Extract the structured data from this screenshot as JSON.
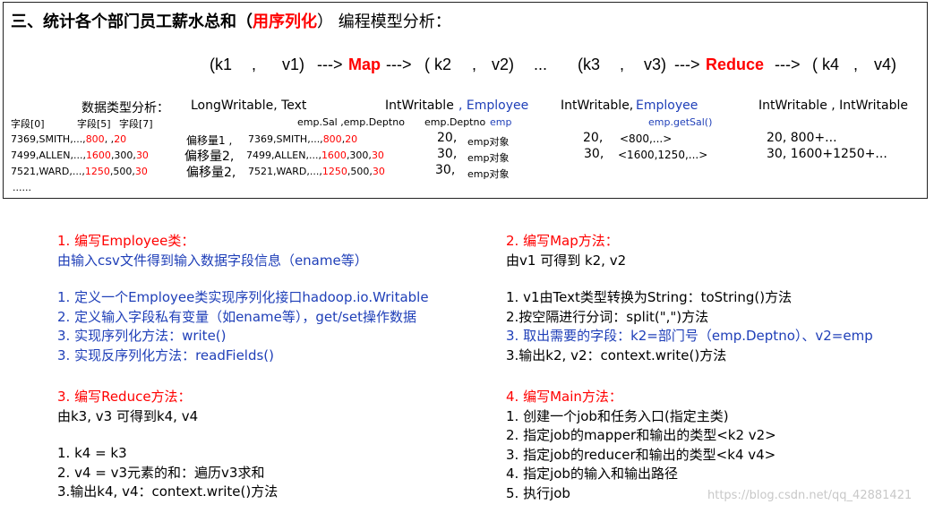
{
  "header": {
    "title_prefix": "三、统计各个部门员工薪水总和（",
    "title_highlight": "用序列化",
    "title_suffix": "） 编程模型分析："
  },
  "flow": {
    "k1": "(k1",
    "sep1": ",",
    "v1": "v1)",
    "arrow1": "--->",
    "map": "Map",
    "arrow2": "--->",
    "k2": "( k2",
    "sep2": ",",
    "v2": "v2)",
    "ellipsis": "...",
    "k3": "(k3",
    "sep3": ",",
    "v3": "v3)",
    "arrow3": "--->",
    "reduce": "Reduce",
    "arrow4": "--->",
    "k4": "( k4",
    "sep4": ",",
    "v4": "v4)"
  },
  "types": {
    "label": "数据类型分析：",
    "t1": "LongWritable,  Text",
    "t2a": "IntWritable",
    "t2b": ", Employee",
    "t3a": "IntWritable,",
    "t3b": "Employee",
    "t4": "IntWritable ,  IntWritable"
  },
  "fields": {
    "col0": "字段[0]",
    "col5": "字段[5]",
    "col7": "字段[7]",
    "empsal": "emp.Sal ,emp.Deptno",
    "empdeptno": "emp.Deptno",
    "emp": "emp",
    "getsal": "emp.getSal()"
  },
  "rows": [
    {
      "a": "7369,SMITH,...,",
      "b": "800",
      "c": ",    ,",
      "d": "20",
      "off": "偏移量1 ,",
      "e": "7369,SMITH,...,",
      "f": "800",
      "g": ",",
      "h": "20",
      "k": "20,",
      "obj": "emp对象",
      "k3": "20,",
      "v3": "<800,...>",
      "res": "20,  800+..."
    },
    {
      "a": "7499,ALLEN,...,",
      "b": "1600",
      "c": ",300,",
      "d": "30",
      "off": "偏移量2,",
      "e": "7499,ALLEN,...,",
      "f": "1600",
      "g": ",300,",
      "h": "30",
      "k": "30,",
      "obj": "emp对象",
      "k3": "30,",
      "v3": "<1600,1250,...>",
      "res": "30, 1600+1250+..."
    },
    {
      "a": "7521,WARD,...,",
      "b": "1250",
      "c": ",500,",
      "d": "30",
      "off": "偏移量2,",
      "e": "7521,WARD,...,",
      "f": "1250",
      "g": ",500,",
      "h": "30",
      "k": "30,",
      "obj": "emp对象",
      "k3": "",
      "v3": "",
      "res": ""
    }
  ],
  "more": "......",
  "sections": {
    "s1": {
      "title": "1. 编写Employee类：",
      "desc": "由输入csv文件得到输入数据字段信息（ename等）",
      "steps": [
        "1. 定义一个Employee类实现序列化接口hadoop.io.Writable",
        "2. 定义输入字段私有变量（如ename等），get/set操作数据",
        "3. 实现序列化方法：write()",
        "3. 实现反序列化方法：readFields()"
      ]
    },
    "s2": {
      "title": "2. 编写Map方法：",
      "desc": "由v1  可得到 k2, v2",
      "steps": [
        "1. v1由Text类型转换为String：toString()方法",
        "2.按空隔进行分词：split(\",\")方法",
        "3. 取出需要的字段：k2=部门号（emp.Deptno）、v2=emp",
        "3.输出k2, v2：context.write()方法"
      ]
    },
    "s3": {
      "title": "3. 编写Reduce方法：",
      "desc": "由k3, v3  可得到k4, v4",
      "steps": [
        "1. k4 = k3",
        "2. v4 = v3元素的和：遍历v3求和",
        "3.输出k4, v4：context.write()方法"
      ]
    },
    "s4": {
      "title": "4. 编写Main方法：",
      "steps": [
        "1. 创建一个job和任务入口(指定主类)",
        "2. 指定job的mapper和输出的类型<k2 v2>",
        "3. 指定job的reducer和输出的类型<k4  v4>",
        "4. 指定job的输入和输出路径",
        "5. 执行job"
      ]
    }
  },
  "watermark": "https://blog.csdn.net/qq_42881421",
  "colors": {
    "red": "#ff0000",
    "blue": "#1f3fb8",
    "border": "#222222",
    "watermark": "#c8c8c8"
  }
}
